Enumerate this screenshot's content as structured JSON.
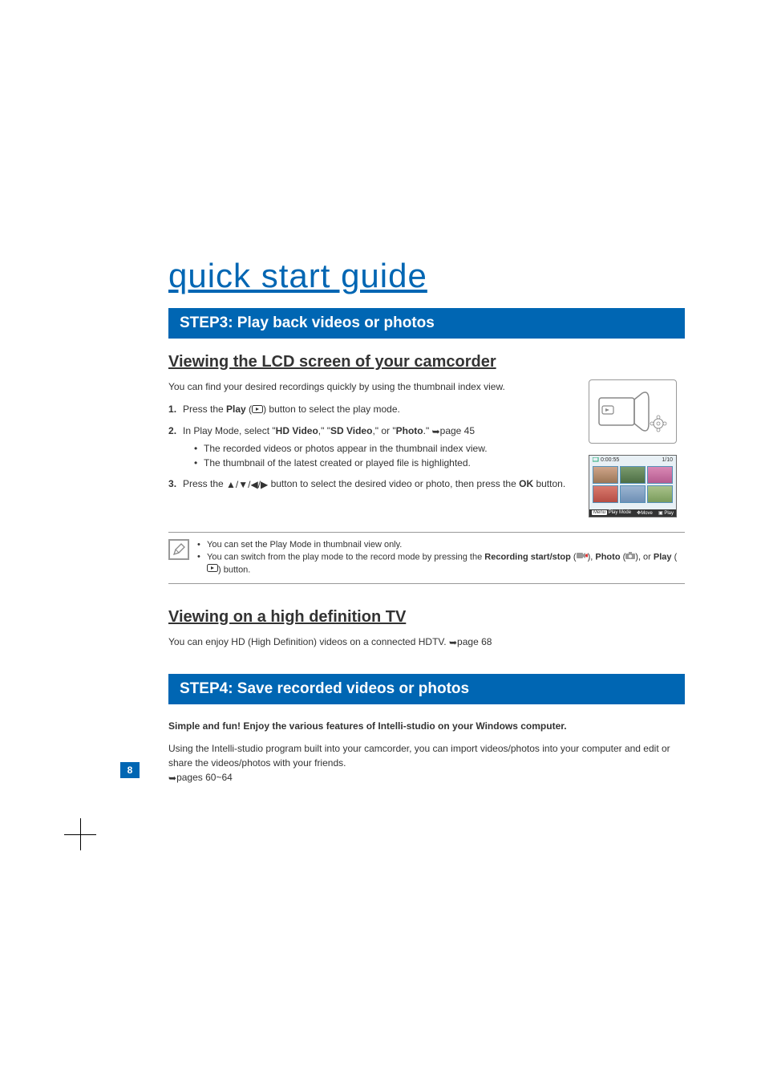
{
  "mainTitle": "quick start guide",
  "step3": {
    "bar": "STEP3: Play back videos or photos",
    "sec1": {
      "title": "Viewing the LCD screen of your camcorder",
      "intro": "You can find your desired recordings quickly by using the thumbnail index view.",
      "li1_a": "Press the ",
      "li1_b": "Play",
      "li1_c": " (",
      "li1_d": ") button to select the play mode.",
      "li2_a": "In Play Mode, select \"",
      "li2_b": "HD Video",
      "li2_c": ",\" \"",
      "li2_d": "SD Video",
      "li2_e": ",\" or \"",
      "li2_f": "Photo",
      "li2_g": ".\" ",
      "li2_h": "page 45",
      "li2_sub1": "The recorded videos or photos appear in the thumbnail index view.",
      "li2_sub2": "The thumbnail of the latest created or played file is highlighted.",
      "li3_a": "Press the ",
      "li3_b": " button to select the desired video or photo, then press the ",
      "li3_c": "OK",
      "li3_d": " button.",
      "note1": "You can set the Play Mode in thumbnail view only.",
      "note2_a": "You can switch from the play mode to the record mode by pressing the ",
      "note2_b": "Recording start/stop",
      "note2_c": " (",
      "note2_d": "), ",
      "note2_e": "Photo",
      "note2_f": " (",
      "note2_g": "), or ",
      "note2_h": "Play",
      "note2_i": " (",
      "note2_j": ") button."
    },
    "sec2": {
      "title": "Viewing on a high definition TV",
      "text_a": "You can enjoy HD (High Definition) videos on a connected HDTV. ",
      "text_b": "page 68"
    }
  },
  "step4": {
    "bar": "STEP4: Save recorded videos or photos",
    "boldIntro": "Simple and fun! Enjoy the various features of Intelli-studio on your Windows computer.",
    "text_a": "Using the Intelli-studio program built into your camcorder, you can import videos/photos into your computer and edit or share the videos/photos with your friends. ",
    "text_b": "pages 60~64"
  },
  "lcd": {
    "topLeft": "0:00:55",
    "topRight": "1/10",
    "menu": "Menu",
    "playMode": "Play Mode",
    "move": "Move",
    "play": "Play"
  },
  "pageNum": "8"
}
